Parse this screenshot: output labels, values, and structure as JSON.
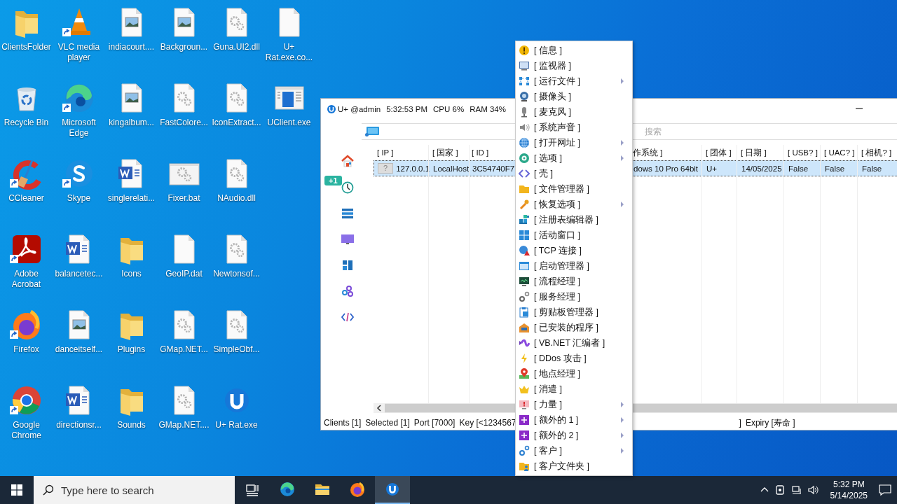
{
  "desktop_icons": [
    {
      "label": "ClientsFolder",
      "shortcut": false
    },
    {
      "label": "Recycle Bin",
      "shortcut": false
    },
    {
      "label": "CCleaner",
      "shortcut": true
    },
    {
      "label": "Adobe Acrobat",
      "shortcut": true
    },
    {
      "label": "Firefox",
      "shortcut": true
    },
    {
      "label": "Google Chrome",
      "shortcut": true
    },
    {
      "label": "VLC media player",
      "shortcut": true
    },
    {
      "label": "Microsoft Edge",
      "shortcut": true
    },
    {
      "label": "Skype",
      "shortcut": true
    },
    {
      "label": "balancetec...",
      "shortcut": false
    },
    {
      "label": "danceitself...",
      "shortcut": false
    },
    {
      "label": "directionsr...",
      "shortcut": false
    },
    {
      "label": "indiacourt....",
      "shortcut": false
    },
    {
      "label": "kingalbum...",
      "shortcut": false
    },
    {
      "label": "singlerelati...",
      "shortcut": false
    },
    {
      "label": "Icons",
      "shortcut": false
    },
    {
      "label": "Plugins",
      "shortcut": false
    },
    {
      "label": "Sounds",
      "shortcut": false
    },
    {
      "label": "Backgroun...",
      "shortcut": false
    },
    {
      "label": "FastColore...",
      "shortcut": false
    },
    {
      "label": "Fixer.bat",
      "shortcut": false
    },
    {
      "label": "GeoIP.dat",
      "shortcut": false
    },
    {
      "label": "GMap.NET...",
      "shortcut": false
    },
    {
      "label": "GMap.NET....",
      "shortcut": false
    },
    {
      "label": "Guna.UI2.dll",
      "shortcut": false
    },
    {
      "label": "IconExtract...",
      "shortcut": false
    },
    {
      "label": "NAudio.dll",
      "shortcut": false
    },
    {
      "label": "Newtonsof...",
      "shortcut": false
    },
    {
      "label": "SimpleObf...",
      "shortcut": false
    },
    {
      "label": "U+ Rat.exe",
      "shortcut": false
    },
    {
      "label": "U+ Rat.exe.co...",
      "shortcut": false
    },
    {
      "label": "UClient.exe",
      "shortcut": false
    }
  ],
  "window": {
    "title": "U+ @admin",
    "time": "5:32:53 PM",
    "cpu": "CPU 6%",
    "ram": "RAM 34%",
    "search": {
      "placeholder": "搜索"
    },
    "sidebar": {
      "badge": "+1"
    },
    "table": {
      "columns": [
        "[ IP ]",
        "[ 国家 ]",
        "[ ID ]",
        "作系统 ]",
        "[ 团体 ]",
        "[ 日期 ]",
        "[ USB? ]",
        "[ UAC? ]",
        "[ 相机? ]"
      ],
      "rows": [
        {
          "selected": true,
          "flag": "?",
          "cells": [
            "127.0.0.1",
            "LocalHost",
            "3C54740F7",
            "dows 10 Pro 64bit",
            "U+",
            "14/05/2025",
            "False",
            "False",
            "False"
          ]
        }
      ]
    },
    "status_bar": [
      "Clients [1]",
      "Selected [1]",
      "Port [7000]",
      "Key [<1234567",
      "]",
      "Expiry [寿命 ]"
    ]
  },
  "context_menu": [
    {
      "label": "[ 信息 ]",
      "submenu": false
    },
    {
      "label": "[ 监视器 ]",
      "submenu": false
    },
    {
      "label": "[ 运行文件 ]",
      "submenu": true
    },
    {
      "label": "[ 摄像头 ]",
      "submenu": false
    },
    {
      "label": "[ 麦克风 ]",
      "submenu": false
    },
    {
      "label": "[ 系统声音 ]",
      "submenu": false
    },
    {
      "label": "[ 打开网址 ]",
      "submenu": true
    },
    {
      "label": "[ 选项 ]",
      "submenu": true
    },
    {
      "label": "[ 壳 ]",
      "submenu": false
    },
    {
      "label": "[ 文件管理器 ]",
      "submenu": false
    },
    {
      "label": "[ 恢复选项 ]",
      "submenu": true
    },
    {
      "label": "[ 注册表编辑器 ]",
      "submenu": false
    },
    {
      "label": "[ 活动窗口 ]",
      "submenu": false
    },
    {
      "label": "[ TCP 连接 ]",
      "submenu": false
    },
    {
      "label": "[ 启动管理器 ]",
      "submenu": false
    },
    {
      "label": "[ 流程经理 ]",
      "submenu": false
    },
    {
      "label": "[ 服务经理 ]",
      "submenu": false
    },
    {
      "label": "[ 剪贴板管理器 ]",
      "submenu": false
    },
    {
      "label": "[ 已安装的程序 ]",
      "submenu": false
    },
    {
      "label": "[ VB.NET 汇编者 ]",
      "submenu": false
    },
    {
      "label": "[ DDos 攻击 ]",
      "submenu": false
    },
    {
      "label": "[ 地点经理 ]",
      "submenu": false
    },
    {
      "label": "[ 消遣 ]",
      "submenu": false
    },
    {
      "label": "[ 力量 ]",
      "submenu": true
    },
    {
      "label": "[ 额外的 1 ]",
      "submenu": true
    },
    {
      "label": "[ 额外的 2 ]",
      "submenu": true
    },
    {
      "label": "[ 客户 ]",
      "submenu": true
    },
    {
      "label": "[ 客户文件夹 ]",
      "submenu": false
    }
  ],
  "taskbar": {
    "search": {
      "placeholder": "Type here to search"
    },
    "apps": [
      {
        "active": false
      },
      {
        "active": false
      },
      {
        "active": false
      },
      {
        "active": true
      }
    ],
    "clock": {
      "time": "5:32 PM",
      "date": "5/14/2025"
    }
  }
}
